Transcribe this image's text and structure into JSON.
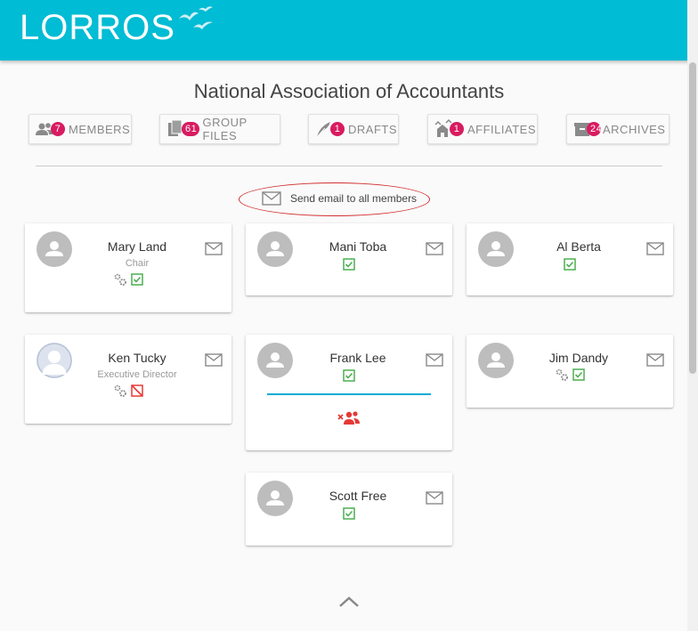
{
  "app": {
    "logo_text": "LORROS"
  },
  "organization": {
    "title": "National Association of Accountants"
  },
  "tabs": [
    {
      "id": "members",
      "icon": "people-icon",
      "badge": "7",
      "label": "MEMBERS"
    },
    {
      "id": "group_files",
      "icon": "files-icon",
      "badge": "61",
      "label": "GROUP FILES"
    },
    {
      "id": "drafts",
      "icon": "quill-icon",
      "badge": "1",
      "label": "DRAFTS"
    },
    {
      "id": "affiliates",
      "icon": "affiliates-icon",
      "badge": "1",
      "label": "AFFILIATES"
    },
    {
      "id": "archives",
      "icon": "archive-icon",
      "badge": "24",
      "label": "ARCHIVES"
    }
  ],
  "email_all": {
    "label": "Send email to all members"
  },
  "members": [
    {
      "name": "Mary Land",
      "role": "Chair",
      "admin": true,
      "status": "checked"
    },
    {
      "name": "Mani Toba",
      "role": "",
      "admin": false,
      "status": "checked"
    },
    {
      "name": "Al Berta",
      "role": "",
      "admin": false,
      "status": "checked"
    },
    {
      "name": "Ken Tucky",
      "role": "Executive Director",
      "admin": true,
      "status": "unchecked-red",
      "photo": true
    },
    {
      "name": "Frank Lee",
      "role": "",
      "admin": false,
      "status": "checked",
      "removed_from_group": true
    },
    {
      "name": "Jim Dandy",
      "role": "",
      "admin": true,
      "status": "checked"
    },
    {
      "name": "Scott Free",
      "role": "",
      "admin": false,
      "status": "checked"
    }
  ],
  "colors": {
    "header": "#00bcd4",
    "badge": "#d81b60",
    "check": "#4caf50",
    "alert": "#e53935"
  }
}
